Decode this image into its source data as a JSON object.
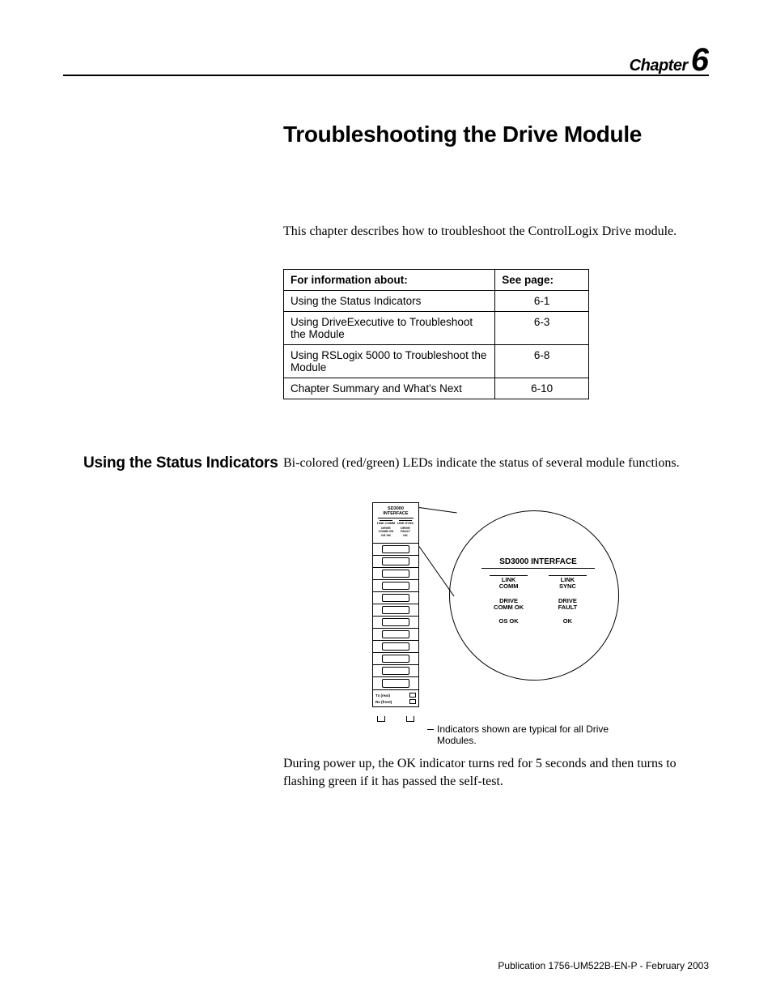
{
  "header": {
    "chapter_word": "Chapter",
    "chapter_num": "6"
  },
  "title": "Troubleshooting the Drive Module",
  "intro": "This chapter describes how to troubleshoot the ControlLogix Drive module.",
  "toc": {
    "head1": "For information about:",
    "head2": "See page:",
    "rows": [
      {
        "topic": "Using the Status Indicators",
        "page": "6-1"
      },
      {
        "topic": "Using DriveExecutive to Troubleshoot the Module",
        "page": "6-3"
      },
      {
        "topic": "Using RSLogix 5000 to Troubleshoot the Module",
        "page": "6-8"
      },
      {
        "topic": "Chapter Summary and What's Next",
        "page": "6-10"
      }
    ]
  },
  "section1": {
    "heading": "Using the Status Indicators",
    "body1": "Bi-colored (red/green) LEDs indicate the status of several module functions.",
    "body2": "During power up, the  OK  indicator turns red for 5 seconds and then turns to flashing green if it has passed the self-test."
  },
  "diagram": {
    "module_title": "SD3000 INTERFACE",
    "small_leds": {
      "col1": [
        "LINK COMM",
        "DRIVE COMM OK",
        "OS OK"
      ],
      "col2": [
        "LINK SYNC",
        "DRIVE FAULT",
        "OK"
      ]
    },
    "ports": {
      "tx": "Tx (rear)",
      "rx": "Rx (front)"
    },
    "circle_title": "SD3000 INTERFACE",
    "circle_leds": [
      {
        "left": "LINK\nCOMM",
        "right": "LINK\nSYNC"
      },
      {
        "left": "DRIVE\nCOMM OK",
        "right": "DRIVE\nFAULT"
      },
      {
        "left": "OS OK",
        "right": "OK"
      }
    ],
    "caption": "Indicators shown are typical for all Drive Modules."
  },
  "footer": "Publication 1756-UM522B-EN-P - February 2003"
}
